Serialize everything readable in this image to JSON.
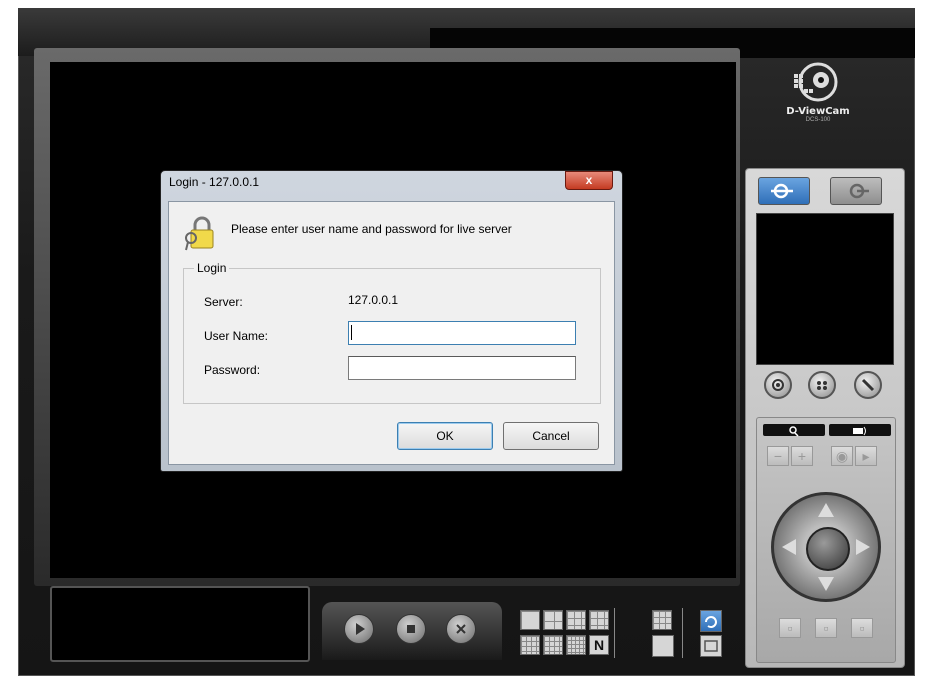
{
  "logo": {
    "name": "D-ViewCam",
    "model": "DCS-100"
  },
  "dialog": {
    "title": "Login - 127.0.0.1",
    "close_glyph": "x",
    "prompt": "Please enter user name and password for live server",
    "group_label": "Login",
    "server_label": "Server:",
    "server_value": "127.0.0.1",
    "username_label": "User Name:",
    "username_value": "",
    "password_label": "Password:",
    "password_value": "",
    "ok_label": "OK",
    "cancel_label": "Cancel"
  },
  "layout_buttons": {
    "n_label": "N"
  },
  "colors": {
    "accent_blue": "#2f6fb8",
    "close_red": "#c43b22",
    "dialog_bg": "#f0f0f0"
  },
  "icons": [
    "connect-icon",
    "disconnect-icon",
    "record-icon",
    "snapshot-icon",
    "settings-icon",
    "zoom-icon",
    "focus-icon",
    "play-icon",
    "stop-icon",
    "close-icon",
    "lock-icon"
  ]
}
